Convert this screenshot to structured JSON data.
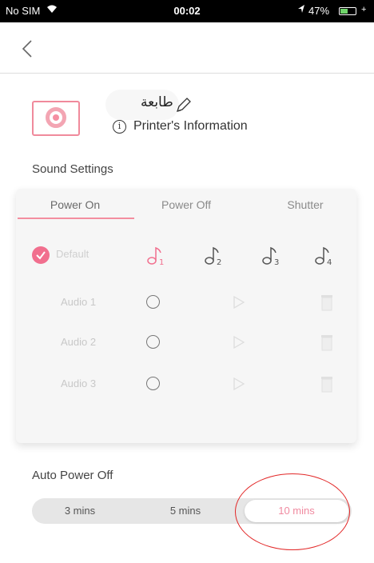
{
  "status_bar": {
    "carrier": "No SIM",
    "time": "00:02",
    "battery_text": "47%",
    "battery_level": 0.47,
    "icons": [
      "wifi-icon",
      "location-arrow-icon",
      "battery-icon",
      "charging-icon"
    ]
  },
  "nav": {
    "back_icon": "chevron-left-icon"
  },
  "printer": {
    "name": "طابعة",
    "info_link": "Printer's Information",
    "icon": "printer-icon"
  },
  "sound_settings": {
    "title": "Sound Settings",
    "tabs": [
      "Power On",
      "Power Off",
      "Shutter"
    ],
    "active_tab": "Power On",
    "default_label": "Default",
    "default_checked": true,
    "tones": [
      "1",
      "2",
      "3",
      "4"
    ],
    "selected_tone": "1",
    "audio_rows": [
      "Audio 1",
      "Audio 2",
      "Audio 3"
    ]
  },
  "auto_power_off": {
    "title": "Auto Power Off",
    "options": [
      "3 mins",
      "5 mins",
      "10 mins"
    ],
    "selected": "10 mins"
  },
  "colors": {
    "accent": "#f16f8e",
    "annotation": "#e22727"
  }
}
